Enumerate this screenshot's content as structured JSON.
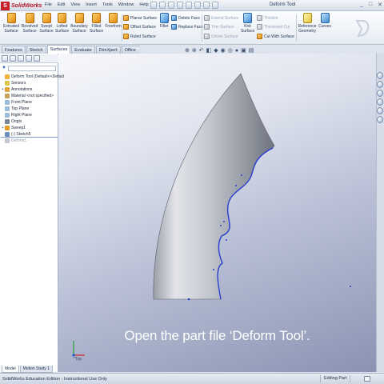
{
  "app": {
    "logo_text": "SolidWorks",
    "document_title": "Deform Tool",
    "controls": [
      "_",
      "□",
      "✕"
    ]
  },
  "menu": [
    "File",
    "Edit",
    "View",
    "Insert",
    "Tools",
    "Window",
    "Help"
  ],
  "ribbon": {
    "large_buttons": [
      {
        "label": "Extruded\nSurface",
        "icon": "extruded-surface-icon"
      },
      {
        "label": "Revolved\nSurface",
        "icon": "revolved-surface-icon"
      },
      {
        "label": "Swept\nSurface",
        "icon": "swept-surface-icon"
      },
      {
        "label": "Lofted\nSurface",
        "icon": "lofted-surface-icon"
      },
      {
        "label": "Boundary\nSurface",
        "icon": "boundary-surface-icon"
      },
      {
        "label": "Filled\nSurface",
        "icon": "filled-surface-icon"
      },
      {
        "label": "Freeform",
        "icon": "freeform-icon"
      }
    ],
    "col1": [
      "Planar Surface",
      "Offset Surface",
      "Ruled Surface"
    ],
    "fillet_label": "Fillet",
    "col2": [
      "Delete Face",
      "Replace Face"
    ],
    "col3": [
      "Extend Surface",
      "Trim Surface",
      "Untrim Surface"
    ],
    "knit_label": "Knit\nSurface",
    "col4": [
      "Thicken",
      "Thickened Cut",
      "Cut With Surface"
    ],
    "ref_geom_label": "Reference\nGeometry",
    "curves_label": "Curves"
  },
  "tabs": [
    {
      "label": "Features",
      "active": false
    },
    {
      "label": "Sketch",
      "active": false
    },
    {
      "label": "Surfaces",
      "active": true
    },
    {
      "label": "Evaluate",
      "active": false
    },
    {
      "label": "DimXpert",
      "active": false
    },
    {
      "label": "Office Products",
      "active": false
    }
  ],
  "tree": [
    {
      "label": "Deform Tool  (Default<<Defaul",
      "icon": "part-icon",
      "expand": "",
      "grey": false
    },
    {
      "label": "Sensors",
      "icon": "sensors-icon",
      "expand": "",
      "grey": false
    },
    {
      "label": "Annotations",
      "icon": "annotations-icon",
      "expand": "+",
      "grey": false
    },
    {
      "label": "Material <not specified>",
      "icon": "material-icon",
      "expand": "",
      "grey": false
    },
    {
      "label": "Front Plane",
      "icon": "plane-icon",
      "expand": "",
      "grey": false
    },
    {
      "label": "Top Plane",
      "icon": "plane-icon",
      "expand": "",
      "grey": false
    },
    {
      "label": "Right Plane",
      "icon": "plane-icon",
      "expand": "",
      "grey": false
    },
    {
      "label": "Origin",
      "icon": "origin-icon",
      "expand": "",
      "grey": false
    },
    {
      "label": "Sweep1",
      "icon": "sweep-icon",
      "expand": "+",
      "grey": false
    },
    {
      "label": "(-) Sketch5",
      "icon": "sketch-icon",
      "expand": "",
      "grey": false
    },
    {
      "label": "Deform1",
      "icon": "deform-icon",
      "expand": "",
      "grey": true
    }
  ],
  "caption": "Open the part file ‘Deform Tool’.",
  "triad_label": "*Top",
  "bottom_tabs": [
    {
      "label": "Model",
      "active": true
    },
    {
      "label": "Motion Study 1",
      "active": false
    }
  ],
  "status": {
    "left": "SolidWorks Education Edition - Instructional Use Only",
    "mode": "Editing Part"
  },
  "colors": {
    "accent": "#2a3fd0",
    "logo_red": "#c8202a"
  }
}
